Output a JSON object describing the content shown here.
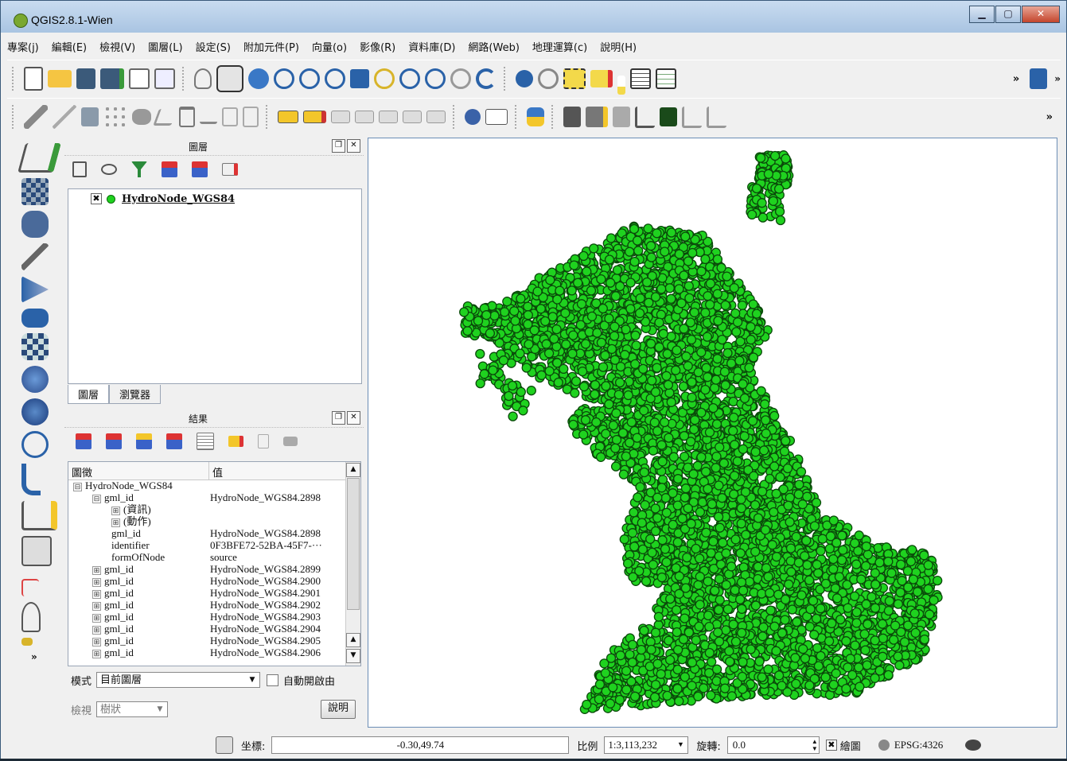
{
  "window": {
    "title": "QGIS2.8.1-Wien",
    "controls": [
      "▁",
      "▢",
      "✕"
    ]
  },
  "menu": [
    "專案(j)",
    "編輯(E)",
    "檢視(V)",
    "圖層(L)",
    "設定(S)",
    "附加元件(P)",
    "向量(o)",
    "影像(R)",
    "資料庫(D)",
    "網路(Web)",
    "地理運算(c)",
    "說明(H)"
  ],
  "toolbar": {
    "overflow": "»"
  },
  "layers_panel": {
    "title": "圖層",
    "layer_name": "HydroNode_WGS84",
    "layer_checked": "✖",
    "tabs": [
      "圖層",
      "瀏覽器"
    ]
  },
  "results_panel": {
    "title": "結果",
    "col_feature": "圖徵",
    "col_value": "值",
    "rows": [
      {
        "level": 0,
        "exp": "⊟",
        "feature": "HydroNode_WGS84",
        "value": ""
      },
      {
        "level": 1,
        "exp": "⊟",
        "feature": "gml_id",
        "value": "HydroNode_WGS84.2898"
      },
      {
        "level": 2,
        "exp": "⊞",
        "feature": "(資訊)",
        "value": ""
      },
      {
        "level": 2,
        "exp": "⊞",
        "feature": "(動作)",
        "value": ""
      },
      {
        "level": 2,
        "exp": "",
        "feature": "gml_id",
        "value": "HydroNode_WGS84.2898"
      },
      {
        "level": 2,
        "exp": "",
        "feature": "identifier",
        "value": "0F3BFE72-52BA-45F7-···"
      },
      {
        "level": 2,
        "exp": "",
        "feature": "formOfNode",
        "value": "source"
      },
      {
        "level": 1,
        "exp": "⊞",
        "feature": "gml_id",
        "value": "HydroNode_WGS84.2899"
      },
      {
        "level": 1,
        "exp": "⊞",
        "feature": "gml_id",
        "value": "HydroNode_WGS84.2900"
      },
      {
        "level": 1,
        "exp": "⊞",
        "feature": "gml_id",
        "value": "HydroNode_WGS84.2901"
      },
      {
        "level": 1,
        "exp": "⊞",
        "feature": "gml_id",
        "value": "HydroNode_WGS84.2902"
      },
      {
        "level": 1,
        "exp": "⊞",
        "feature": "gml_id",
        "value": "HydroNode_WGS84.2903"
      },
      {
        "level": 1,
        "exp": "⊞",
        "feature": "gml_id",
        "value": "HydroNode_WGS84.2904"
      },
      {
        "level": 1,
        "exp": "⊞",
        "feature": "gml_id",
        "value": "HydroNode_WGS84.2905"
      },
      {
        "level": 1,
        "exp": "⊞",
        "feature": "gml_id",
        "value": "HydroNode_WGS84.2906"
      }
    ],
    "mode_label": "模式",
    "mode_value": "目前圖層",
    "auto_open_label": "自動開啟由",
    "view_label": "檢視",
    "view_value": "樹狀",
    "help_button": "說明"
  },
  "statusbar": {
    "coord_label": "坐標:",
    "coord_value": "-0.30,49.74",
    "scale_label": "比例",
    "scale_value": "1:3,113,232",
    "rotation_label": "旋轉:",
    "rotation_value": "0.0",
    "render_label": "繪圖",
    "render_checked": "✖",
    "crs": "EPSG:4326"
  },
  "colors": {
    "point_fill": "#1fd21f",
    "point_stroke": "#0a4a0a",
    "accent": "#6b8db5"
  },
  "icons": [
    "new-project-icon",
    "open-project-icon",
    "save-icon",
    "save-as-icon",
    "new-print-composer-icon",
    "composer-manager-icon",
    "touch-zoom-icon",
    "pan-icon",
    "pan-to-selection-icon",
    "zoom-in-icon",
    "zoom-out-icon",
    "zoom-native-icon",
    "zoom-full-icon",
    "zoom-to-selection-icon",
    "zoom-to-layer-icon",
    "zoom-last-icon",
    "zoom-next-icon",
    "refresh-icon",
    "identify-icon",
    "action-icon",
    "select-icon",
    "deselect-icon",
    "expression-icon",
    "attribute-table-icon",
    "statistics-icon",
    "help-icon"
  ]
}
